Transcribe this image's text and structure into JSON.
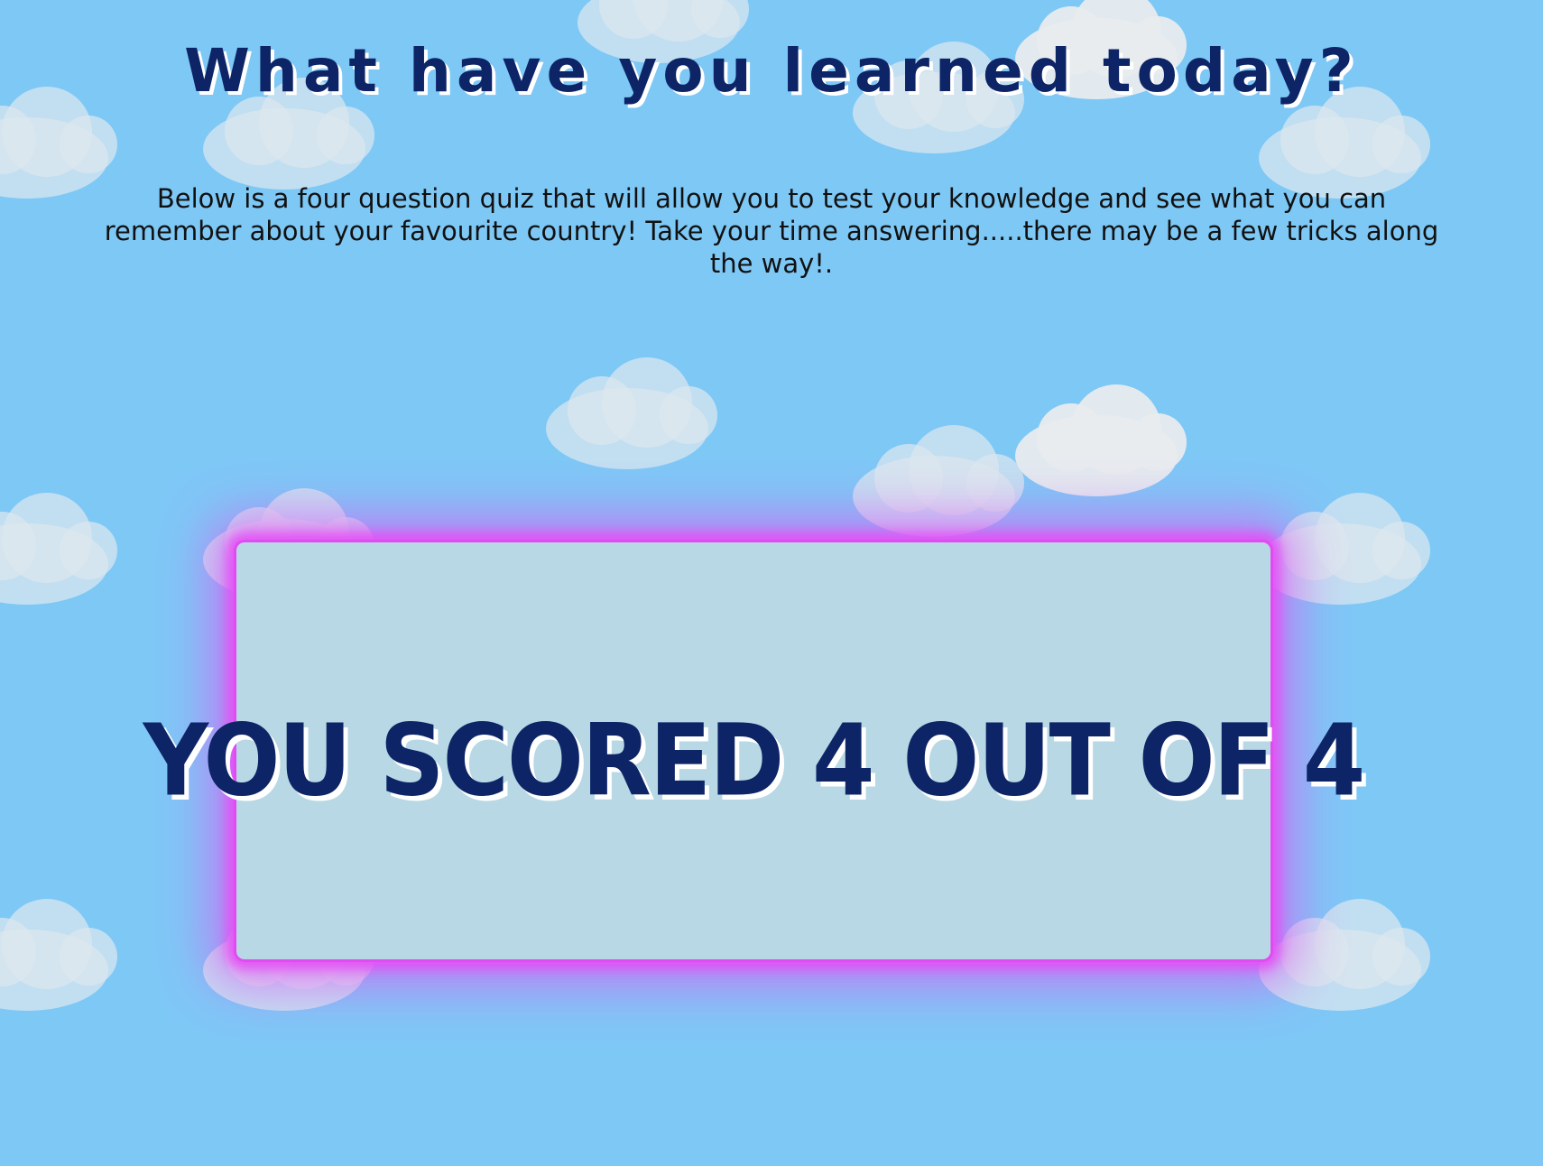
{
  "page": {
    "title": "What have you learned today?",
    "intro": "Below is a four question quiz that will allow you to test your knowledge and see what you can remember about your favourite country! Take your time answering.....there may be a few tricks along the way!."
  },
  "result": {
    "score_text": "YOU SCORED 4 OUT OF 4",
    "score": 4,
    "total": 4
  },
  "colors": {
    "background": "#7ec8f6",
    "title": "#0d2466",
    "card": "#b7d8e4",
    "glow": "#e04cf2",
    "cloud": "#dce8ee"
  }
}
